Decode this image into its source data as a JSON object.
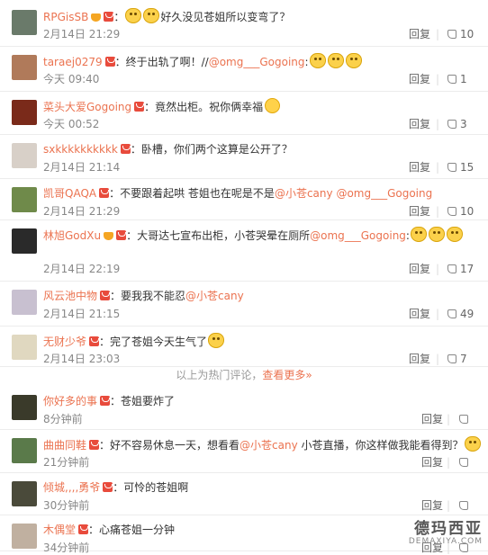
{
  "comments": [
    {
      "user": "RPGisSB",
      "crown": true,
      "text": "：",
      "emoji_before_text": 2,
      "text2": "好久没见苍姐所以变弯了？",
      "mentions": [],
      "tail": "",
      "tail_emojis": 0,
      "time": "2月14日 21:29",
      "reply": "回复",
      "likes": "10"
    },
    {
      "user": "taraej0279",
      "crown": false,
      "text": "：终于出轨了啊！//",
      "mentions": [
        "@omg___Gogoing"
      ],
      "tail": ":",
      "tail_emojis": 3,
      "time": "今天 09:40",
      "reply": "回复",
      "likes": "1"
    },
    {
      "user": "菜头大爱Gogoing",
      "crown": false,
      "text": "：竟然出柜。祝你俩幸福",
      "mentions": [],
      "tail": "",
      "tail_emojis": 0,
      "laugh": true,
      "time": "今天 00:52",
      "reply": "回复",
      "likes": "3"
    },
    {
      "user": "sxkkkkkkkkkk",
      "crown": false,
      "text": "：卧槽，你们两个这算是公开了？",
      "mentions": [],
      "tail": "",
      "tail_emojis": 0,
      "time": "2月14日 21:14",
      "reply": "回复",
      "likes": "15"
    },
    {
      "user": "凯哥QAQA",
      "crown": false,
      "text": "：不要跟着起哄  苍姐也在呢是不是",
      "mentions": [
        "@小苍cany",
        "@omg___Gogoing"
      ],
      "tail": "",
      "tail_emojis": 0,
      "time": "2月14日 21:29",
      "reply": "回复",
      "likes": "10"
    },
    {
      "user": "林旭GodXu",
      "crown": true,
      "text": "：大哥达七宣布出柜，小苍哭晕在厕所",
      "mentions": [
        "@omg___Gogoing"
      ],
      "tail": ":",
      "tail_emojis": 3,
      "time": "2月14日 22:19",
      "reply": "回复",
      "likes": "17"
    },
    {
      "user": "风云池中物",
      "crown": false,
      "text": "：要我我不能忍",
      "mentions": [
        "@小苍cany"
      ],
      "tail": "",
      "tail_emojis": 0,
      "time": "2月14日 21:15",
      "reply": "回复",
      "likes": "49"
    },
    {
      "user": "无财少爷",
      "crown": false,
      "text": "：完了苍姐今天生气了",
      "mentions": [],
      "tail": "",
      "tail_emojis": 1,
      "time": "2月14日 23:03",
      "reply": "回复",
      "likes": "7"
    },
    {
      "user": "你好多的事",
      "crown": false,
      "text": "：苍姐要炸了",
      "mentions": [],
      "tail": "",
      "tail_emojis": 0,
      "time": "8分钟前",
      "reply": "回复",
      "likes": ""
    },
    {
      "user": "曲曲同鞋",
      "crown": false,
      "text": "：好不容易休息一天，想看看",
      "mentions": [
        "@小苍cany"
      ],
      "tail": " 小苍直播，你这样做我能看得到？",
      "tail_emojis": 1,
      "time": "21分钟前",
      "reply": "回复",
      "likes": ""
    },
    {
      "user": "倾城,,,,勇爷",
      "crown": false,
      "text": "：可怜的苍姐啊",
      "mentions": [],
      "tail": "",
      "tail_emojis": 0,
      "time": "30分钟前",
      "reply": "回复",
      "likes": ""
    },
    {
      "user": "木偶堂",
      "crown": false,
      "text": "：心痛苍姐一分钟",
      "mentions": [],
      "tail": "",
      "tail_emojis": 0,
      "time": "34分钟前",
      "reply": "回复",
      "likes": ""
    }
  ],
  "divider": {
    "text": "以上为热门评论，",
    "more": "查看更多»"
  },
  "watermark": {
    "big": "德玛西亚",
    "small": "DEMAXIYA.COM"
  },
  "colors": {
    "username": "#eb7350",
    "mention": "#eb7350",
    "vip_badge": "#e84b3c"
  },
  "avatar_colors": [
    "#6a7a6a",
    "#b07a5a",
    "#7a2a1a",
    "#d8d0c8",
    "#6f8a4a",
    "#2a2a2a",
    "#c8c0d0",
    "#e0d8c0",
    "#3a3a2a",
    "#5a7a4a",
    "#4a4a3a",
    "#c0b0a0"
  ]
}
